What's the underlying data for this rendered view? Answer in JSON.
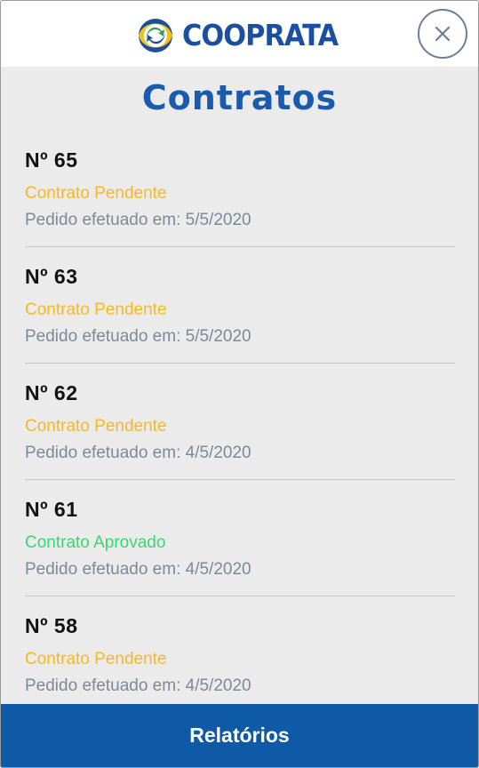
{
  "header": {
    "logo_text": "COOPRATA",
    "close_icon": "close-icon"
  },
  "page": {
    "title": "Contratos"
  },
  "contracts": [
    {
      "number": "Nº 65",
      "status": "Contrato Pendente",
      "date": "Pedido efetuado em: 5/5/2020"
    },
    {
      "number": "Nº 63",
      "status": "Contrato Pendente",
      "date": "Pedido efetuado em: 5/5/2020"
    },
    {
      "number": "Nº 62",
      "status": "Contrato Pendente",
      "date": "Pedido efetuado em: 4/5/2020"
    },
    {
      "number": "Nº 61",
      "status": "Contrato Aprovado",
      "date": "Pedido efetuado em: 4/5/2020"
    },
    {
      "number": "Nº 58",
      "status": "Contrato Pendente",
      "date": "Pedido efetuado em: 4/5/2020"
    }
  ],
  "footer": {
    "reports_label": "Relatórios"
  },
  "colors": {
    "brand_blue": "#1b4fa0",
    "pending": "#f6b825",
    "approved": "#37d86f",
    "footer": "#0e5aa7"
  }
}
